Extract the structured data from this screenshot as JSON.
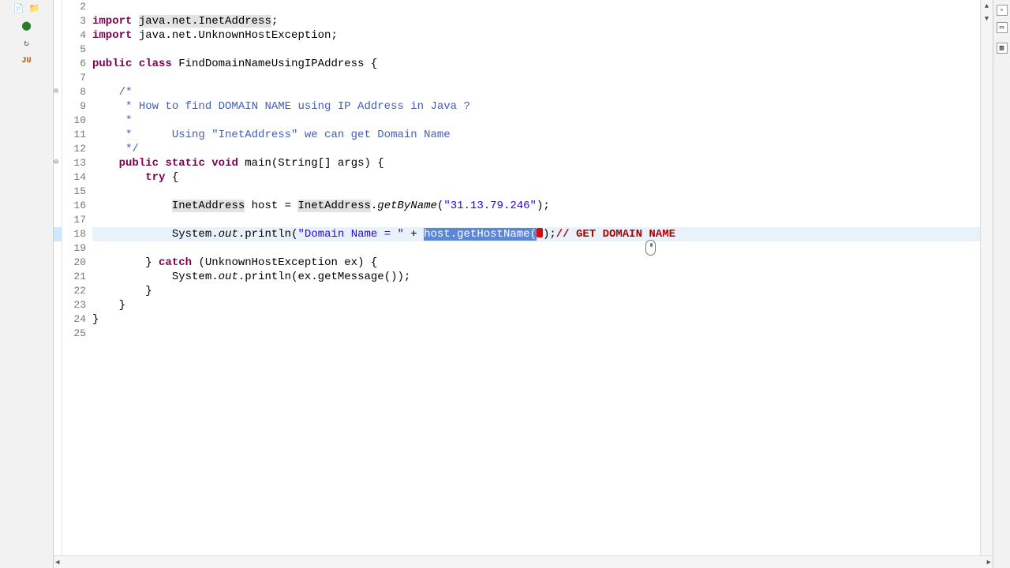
{
  "left_toolbar": {
    "icons": [
      "history-icon",
      "package-hierarchy-icon",
      "callers-icon",
      "refresh-icon",
      "junit-icon"
    ]
  },
  "right_toolbar": {
    "icons": [
      "expand-icon",
      "maximize-icon",
      "outline-icon"
    ]
  },
  "code": {
    "highlighted_line": 18,
    "lines": [
      {
        "n": 2,
        "pre": ""
      },
      {
        "n": 3,
        "pre": "",
        "segs": [
          [
            "kw",
            "import"
          ],
          [
            "txt",
            " "
          ],
          [
            "type-hl",
            "java.net.InetAddress"
          ],
          [
            "txt",
            ";"
          ]
        ]
      },
      {
        "n": 4,
        "pre": "",
        "segs": [
          [
            "kw",
            "import"
          ],
          [
            "txt",
            " java.net.UnknownHostException;"
          ]
        ]
      },
      {
        "n": 5,
        "pre": ""
      },
      {
        "n": 6,
        "pre": "",
        "segs": [
          [
            "kw",
            "public"
          ],
          [
            "txt",
            " "
          ],
          [
            "kw",
            "class"
          ],
          [
            "txt",
            " FindDomainNameUsingIPAddress {"
          ]
        ]
      },
      {
        "n": 7,
        "pre": ""
      },
      {
        "n": 8,
        "pre": "    ",
        "fold": true,
        "segs": [
          [
            "javadoc",
            "/*"
          ]
        ]
      },
      {
        "n": 9,
        "pre": "    ",
        "segs": [
          [
            "javadoc",
            " * How to find DOMAIN NAME using IP Address in Java ?"
          ]
        ]
      },
      {
        "n": 10,
        "pre": "    ",
        "segs": [
          [
            "javadoc",
            " *"
          ]
        ]
      },
      {
        "n": 11,
        "pre": "    ",
        "segs": [
          [
            "javadoc",
            " *      Using \"InetAddress\" we can get Domain Name"
          ]
        ]
      },
      {
        "n": 12,
        "pre": "    ",
        "segs": [
          [
            "javadoc",
            " */"
          ]
        ]
      },
      {
        "n": 13,
        "pre": "    ",
        "fold": true,
        "segs": [
          [
            "kw",
            "public"
          ],
          [
            "txt",
            " "
          ],
          [
            "kw",
            "static"
          ],
          [
            "txt",
            " "
          ],
          [
            "kw",
            "void"
          ],
          [
            "txt",
            " main(String[] args) {"
          ]
        ]
      },
      {
        "n": 14,
        "pre": "        ",
        "segs": [
          [
            "kw",
            "try"
          ],
          [
            "txt",
            " {"
          ]
        ]
      },
      {
        "n": 15,
        "pre": ""
      },
      {
        "n": 16,
        "pre": "            ",
        "segs": [
          [
            "type-hl",
            "InetAddress"
          ],
          [
            "txt",
            " host = "
          ],
          [
            "type-hl",
            "InetAddress"
          ],
          [
            "txt",
            "."
          ],
          [
            "static-ital",
            "getByName"
          ],
          [
            "txt",
            "("
          ],
          [
            "str",
            "\"31.13.79.246\""
          ],
          [
            "txt",
            ");"
          ]
        ]
      },
      {
        "n": 17,
        "pre": ""
      },
      {
        "n": 18,
        "pre": "            ",
        "segs": [
          [
            "txt",
            "System."
          ],
          [
            "static-ital",
            "out"
          ],
          [
            "txt",
            ".println("
          ],
          [
            "str",
            "\"Domain Name = \""
          ],
          [
            "txt",
            " + "
          ],
          [
            "selection",
            "host.getHostName("
          ],
          [
            "red-caret-dot",
            ""
          ],
          [
            "txt",
            ");"
          ],
          [
            "red-comment",
            "// GET DOMAIN NAME"
          ]
        ]
      },
      {
        "n": 19,
        "pre": ""
      },
      {
        "n": 20,
        "pre": "        ",
        "segs": [
          [
            "txt",
            "} "
          ],
          [
            "kw",
            "catch"
          ],
          [
            "txt",
            " (UnknownHostException ex) {"
          ]
        ]
      },
      {
        "n": 21,
        "pre": "            ",
        "segs": [
          [
            "txt",
            "System."
          ],
          [
            "static-ital",
            "out"
          ],
          [
            "txt",
            ".println(ex.getMessage());"
          ]
        ]
      },
      {
        "n": 22,
        "pre": "        ",
        "segs": [
          [
            "txt",
            "}"
          ]
        ]
      },
      {
        "n": 23,
        "pre": "    ",
        "segs": [
          [
            "txt",
            "}"
          ]
        ]
      },
      {
        "n": 24,
        "pre": "",
        "segs": [
          [
            "txt",
            "}"
          ]
        ]
      },
      {
        "n": 25,
        "pre": ""
      }
    ]
  }
}
